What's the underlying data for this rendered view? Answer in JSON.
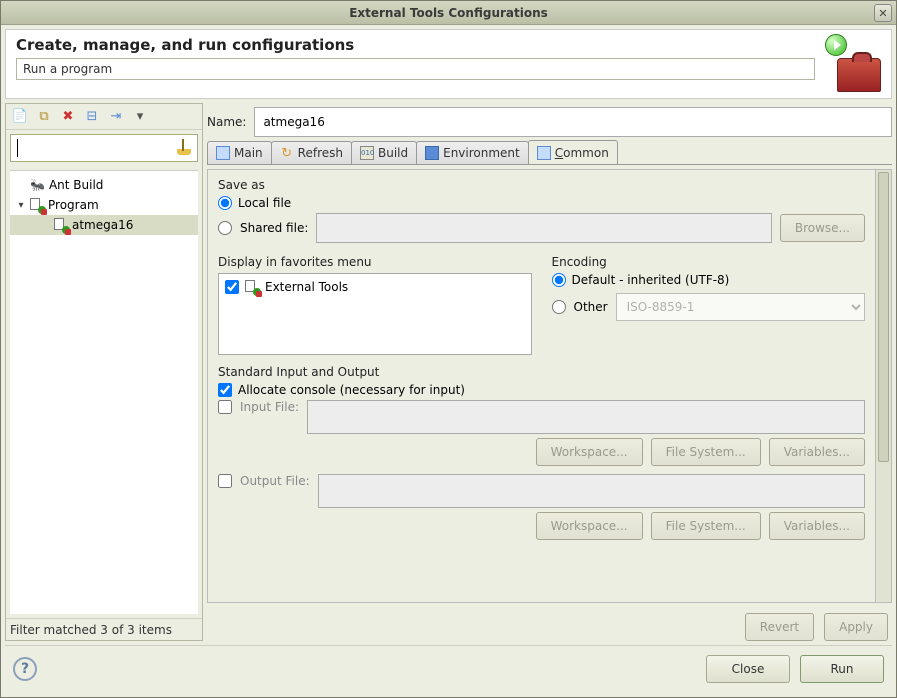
{
  "window": {
    "title": "External Tools Configurations"
  },
  "header": {
    "title": "Create, manage, and run configurations",
    "subtitle": "Run a program"
  },
  "leftPane": {
    "items": {
      "ant": "Ant Build",
      "program": "Program",
      "atmega": "atmega16"
    },
    "status": "Filter matched 3 of 3 items"
  },
  "name": {
    "label": "Name:",
    "value": "atmega16"
  },
  "tabs": {
    "main": "Main",
    "refresh": "Refresh",
    "build": "Build",
    "environment": "Environment",
    "common": "Common"
  },
  "common": {
    "saveAs": {
      "title": "Save as",
      "local": "Local file",
      "shared": "Shared file:",
      "browse": "Browse..."
    },
    "favorites": {
      "title": "Display in favorites menu",
      "item": "External Tools"
    },
    "encoding": {
      "title": "Encoding",
      "default": "Default - inherited (UTF-8)",
      "other": "Other",
      "otherValue": "ISO-8859-1"
    },
    "io": {
      "title": "Standard Input and Output",
      "allocate": "Allocate console (necessary for input)",
      "inputFile": "Input File:",
      "outputFile": "Output File:",
      "workspace": "Workspace...",
      "filesystem": "File System...",
      "variables": "Variables..."
    }
  },
  "actions": {
    "revert": "Revert",
    "apply": "Apply"
  },
  "footer": {
    "close": "Close",
    "run": "Run"
  }
}
